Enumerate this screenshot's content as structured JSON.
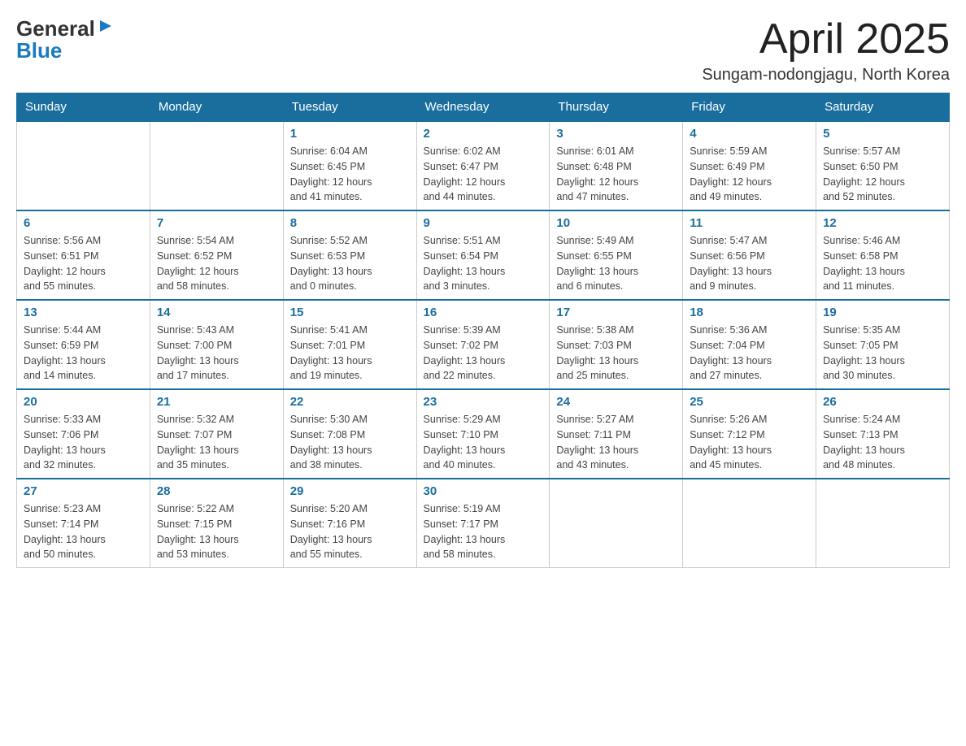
{
  "header": {
    "title": "April 2025",
    "location": "Sungam-nodongjagu, North Korea",
    "logo_general": "General",
    "logo_blue": "Blue"
  },
  "calendar": {
    "days_of_week": [
      "Sunday",
      "Monday",
      "Tuesday",
      "Wednesday",
      "Thursday",
      "Friday",
      "Saturday"
    ],
    "weeks": [
      [
        {
          "day": "",
          "info": ""
        },
        {
          "day": "",
          "info": ""
        },
        {
          "day": "1",
          "info": "Sunrise: 6:04 AM\nSunset: 6:45 PM\nDaylight: 12 hours\nand 41 minutes."
        },
        {
          "day": "2",
          "info": "Sunrise: 6:02 AM\nSunset: 6:47 PM\nDaylight: 12 hours\nand 44 minutes."
        },
        {
          "day": "3",
          "info": "Sunrise: 6:01 AM\nSunset: 6:48 PM\nDaylight: 12 hours\nand 47 minutes."
        },
        {
          "day": "4",
          "info": "Sunrise: 5:59 AM\nSunset: 6:49 PM\nDaylight: 12 hours\nand 49 minutes."
        },
        {
          "day": "5",
          "info": "Sunrise: 5:57 AM\nSunset: 6:50 PM\nDaylight: 12 hours\nand 52 minutes."
        }
      ],
      [
        {
          "day": "6",
          "info": "Sunrise: 5:56 AM\nSunset: 6:51 PM\nDaylight: 12 hours\nand 55 minutes."
        },
        {
          "day": "7",
          "info": "Sunrise: 5:54 AM\nSunset: 6:52 PM\nDaylight: 12 hours\nand 58 minutes."
        },
        {
          "day": "8",
          "info": "Sunrise: 5:52 AM\nSunset: 6:53 PM\nDaylight: 13 hours\nand 0 minutes."
        },
        {
          "day": "9",
          "info": "Sunrise: 5:51 AM\nSunset: 6:54 PM\nDaylight: 13 hours\nand 3 minutes."
        },
        {
          "day": "10",
          "info": "Sunrise: 5:49 AM\nSunset: 6:55 PM\nDaylight: 13 hours\nand 6 minutes."
        },
        {
          "day": "11",
          "info": "Sunrise: 5:47 AM\nSunset: 6:56 PM\nDaylight: 13 hours\nand 9 minutes."
        },
        {
          "day": "12",
          "info": "Sunrise: 5:46 AM\nSunset: 6:58 PM\nDaylight: 13 hours\nand 11 minutes."
        }
      ],
      [
        {
          "day": "13",
          "info": "Sunrise: 5:44 AM\nSunset: 6:59 PM\nDaylight: 13 hours\nand 14 minutes."
        },
        {
          "day": "14",
          "info": "Sunrise: 5:43 AM\nSunset: 7:00 PM\nDaylight: 13 hours\nand 17 minutes."
        },
        {
          "day": "15",
          "info": "Sunrise: 5:41 AM\nSunset: 7:01 PM\nDaylight: 13 hours\nand 19 minutes."
        },
        {
          "day": "16",
          "info": "Sunrise: 5:39 AM\nSunset: 7:02 PM\nDaylight: 13 hours\nand 22 minutes."
        },
        {
          "day": "17",
          "info": "Sunrise: 5:38 AM\nSunset: 7:03 PM\nDaylight: 13 hours\nand 25 minutes."
        },
        {
          "day": "18",
          "info": "Sunrise: 5:36 AM\nSunset: 7:04 PM\nDaylight: 13 hours\nand 27 minutes."
        },
        {
          "day": "19",
          "info": "Sunrise: 5:35 AM\nSunset: 7:05 PM\nDaylight: 13 hours\nand 30 minutes."
        }
      ],
      [
        {
          "day": "20",
          "info": "Sunrise: 5:33 AM\nSunset: 7:06 PM\nDaylight: 13 hours\nand 32 minutes."
        },
        {
          "day": "21",
          "info": "Sunrise: 5:32 AM\nSunset: 7:07 PM\nDaylight: 13 hours\nand 35 minutes."
        },
        {
          "day": "22",
          "info": "Sunrise: 5:30 AM\nSunset: 7:08 PM\nDaylight: 13 hours\nand 38 minutes."
        },
        {
          "day": "23",
          "info": "Sunrise: 5:29 AM\nSunset: 7:10 PM\nDaylight: 13 hours\nand 40 minutes."
        },
        {
          "day": "24",
          "info": "Sunrise: 5:27 AM\nSunset: 7:11 PM\nDaylight: 13 hours\nand 43 minutes."
        },
        {
          "day": "25",
          "info": "Sunrise: 5:26 AM\nSunset: 7:12 PM\nDaylight: 13 hours\nand 45 minutes."
        },
        {
          "day": "26",
          "info": "Sunrise: 5:24 AM\nSunset: 7:13 PM\nDaylight: 13 hours\nand 48 minutes."
        }
      ],
      [
        {
          "day": "27",
          "info": "Sunrise: 5:23 AM\nSunset: 7:14 PM\nDaylight: 13 hours\nand 50 minutes."
        },
        {
          "day": "28",
          "info": "Sunrise: 5:22 AM\nSunset: 7:15 PM\nDaylight: 13 hours\nand 53 minutes."
        },
        {
          "day": "29",
          "info": "Sunrise: 5:20 AM\nSunset: 7:16 PM\nDaylight: 13 hours\nand 55 minutes."
        },
        {
          "day": "30",
          "info": "Sunrise: 5:19 AM\nSunset: 7:17 PM\nDaylight: 13 hours\nand 58 minutes."
        },
        {
          "day": "",
          "info": ""
        },
        {
          "day": "",
          "info": ""
        },
        {
          "day": "",
          "info": ""
        }
      ]
    ]
  }
}
